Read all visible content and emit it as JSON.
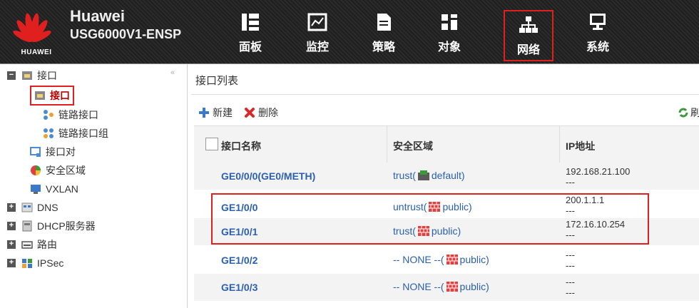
{
  "header": {
    "logo_text": "HUAWEI",
    "brand": "Huawei",
    "device": "USG6000V1-ENSP",
    "nav": [
      {
        "label": "面板",
        "icon": "dashboard-icon"
      },
      {
        "label": "监控",
        "icon": "monitor-chart-icon"
      },
      {
        "label": "策略",
        "icon": "policy-document-icon"
      },
      {
        "label": "对象",
        "icon": "object-icon"
      },
      {
        "label": "网络",
        "icon": "network-topology-icon",
        "active": true
      },
      {
        "label": "系统",
        "icon": "system-computer-icon"
      }
    ]
  },
  "sidebar": {
    "collapse_icon": "«",
    "items": [
      {
        "label": "接口",
        "toggle": "−"
      },
      {
        "label": "接口",
        "selected": true
      },
      {
        "label": "链路接口"
      },
      {
        "label": "链路接口组"
      },
      {
        "label": "接口对"
      },
      {
        "label": "安全区域"
      },
      {
        "label": "VXLAN"
      },
      {
        "label": "DNS",
        "toggle": "+"
      },
      {
        "label": "DHCP服务器",
        "toggle": "+"
      },
      {
        "label": "路由",
        "toggle": "+"
      },
      {
        "label": "IPSec",
        "toggle": "+"
      }
    ]
  },
  "main": {
    "title": "接口列表",
    "toolbar": {
      "new": "新建",
      "delete": "删除",
      "refresh": "刷"
    },
    "columns": [
      "接口名称",
      "安全区域",
      "IP地址"
    ],
    "rows": [
      {
        "name": "GE0/0/0(GE0/METH)",
        "zone_prefix": "trust(",
        "zone_suffix": " default)",
        "ip1": "192.168.21.100",
        "ip2": "---"
      },
      {
        "name": "GE1/0/0",
        "zone_prefix": "untrust(",
        "zone_suffix": " public)",
        "ip1": "200.1.1.1",
        "ip2": "---"
      },
      {
        "name": "GE1/0/1",
        "zone_prefix": "trust(",
        "zone_suffix": " public)",
        "ip1": "172.16.10.254",
        "ip2": "---"
      },
      {
        "name": "GE1/0/2",
        "zone_prefix": "-- NONE --(",
        "zone_suffix": " public)",
        "ip1": "---",
        "ip2": "---"
      },
      {
        "name": "GE1/0/3",
        "zone_prefix": "-- NONE --(",
        "zone_suffix": " public)",
        "ip1": "---",
        "ip2": "---"
      }
    ]
  },
  "colors": {
    "accent_red": "#e0201e",
    "link_blue": "#2a5fb3",
    "header_bg": "#222222"
  }
}
